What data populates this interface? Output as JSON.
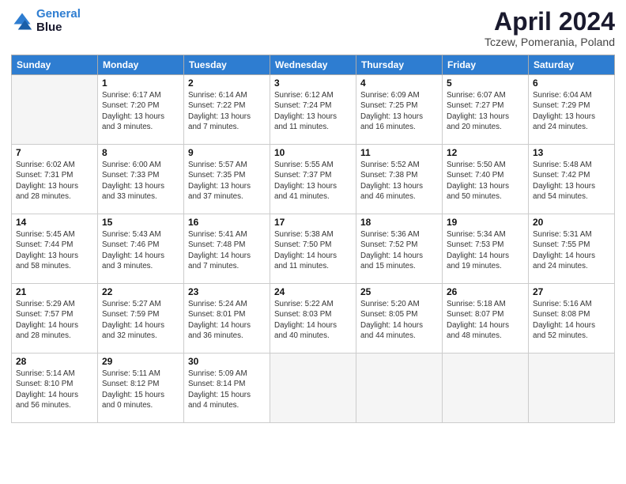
{
  "logo": {
    "line1": "General",
    "line2": "Blue"
  },
  "title": "April 2024",
  "location": "Tczew, Pomerania, Poland",
  "headers": [
    "Sunday",
    "Monday",
    "Tuesday",
    "Wednesday",
    "Thursday",
    "Friday",
    "Saturday"
  ],
  "weeks": [
    [
      {
        "day": "",
        "info": ""
      },
      {
        "day": "1",
        "info": "Sunrise: 6:17 AM\nSunset: 7:20 PM\nDaylight: 13 hours\nand 3 minutes."
      },
      {
        "day": "2",
        "info": "Sunrise: 6:14 AM\nSunset: 7:22 PM\nDaylight: 13 hours\nand 7 minutes."
      },
      {
        "day": "3",
        "info": "Sunrise: 6:12 AM\nSunset: 7:24 PM\nDaylight: 13 hours\nand 11 minutes."
      },
      {
        "day": "4",
        "info": "Sunrise: 6:09 AM\nSunset: 7:25 PM\nDaylight: 13 hours\nand 16 minutes."
      },
      {
        "day": "5",
        "info": "Sunrise: 6:07 AM\nSunset: 7:27 PM\nDaylight: 13 hours\nand 20 minutes."
      },
      {
        "day": "6",
        "info": "Sunrise: 6:04 AM\nSunset: 7:29 PM\nDaylight: 13 hours\nand 24 minutes."
      }
    ],
    [
      {
        "day": "7",
        "info": "Sunrise: 6:02 AM\nSunset: 7:31 PM\nDaylight: 13 hours\nand 28 minutes."
      },
      {
        "day": "8",
        "info": "Sunrise: 6:00 AM\nSunset: 7:33 PM\nDaylight: 13 hours\nand 33 minutes."
      },
      {
        "day": "9",
        "info": "Sunrise: 5:57 AM\nSunset: 7:35 PM\nDaylight: 13 hours\nand 37 minutes."
      },
      {
        "day": "10",
        "info": "Sunrise: 5:55 AM\nSunset: 7:37 PM\nDaylight: 13 hours\nand 41 minutes."
      },
      {
        "day": "11",
        "info": "Sunrise: 5:52 AM\nSunset: 7:38 PM\nDaylight: 13 hours\nand 46 minutes."
      },
      {
        "day": "12",
        "info": "Sunrise: 5:50 AM\nSunset: 7:40 PM\nDaylight: 13 hours\nand 50 minutes."
      },
      {
        "day": "13",
        "info": "Sunrise: 5:48 AM\nSunset: 7:42 PM\nDaylight: 13 hours\nand 54 minutes."
      }
    ],
    [
      {
        "day": "14",
        "info": "Sunrise: 5:45 AM\nSunset: 7:44 PM\nDaylight: 13 hours\nand 58 minutes."
      },
      {
        "day": "15",
        "info": "Sunrise: 5:43 AM\nSunset: 7:46 PM\nDaylight: 14 hours\nand 3 minutes."
      },
      {
        "day": "16",
        "info": "Sunrise: 5:41 AM\nSunset: 7:48 PM\nDaylight: 14 hours\nand 7 minutes."
      },
      {
        "day": "17",
        "info": "Sunrise: 5:38 AM\nSunset: 7:50 PM\nDaylight: 14 hours\nand 11 minutes."
      },
      {
        "day": "18",
        "info": "Sunrise: 5:36 AM\nSunset: 7:52 PM\nDaylight: 14 hours\nand 15 minutes."
      },
      {
        "day": "19",
        "info": "Sunrise: 5:34 AM\nSunset: 7:53 PM\nDaylight: 14 hours\nand 19 minutes."
      },
      {
        "day": "20",
        "info": "Sunrise: 5:31 AM\nSunset: 7:55 PM\nDaylight: 14 hours\nand 24 minutes."
      }
    ],
    [
      {
        "day": "21",
        "info": "Sunrise: 5:29 AM\nSunset: 7:57 PM\nDaylight: 14 hours\nand 28 minutes."
      },
      {
        "day": "22",
        "info": "Sunrise: 5:27 AM\nSunset: 7:59 PM\nDaylight: 14 hours\nand 32 minutes."
      },
      {
        "day": "23",
        "info": "Sunrise: 5:24 AM\nSunset: 8:01 PM\nDaylight: 14 hours\nand 36 minutes."
      },
      {
        "day": "24",
        "info": "Sunrise: 5:22 AM\nSunset: 8:03 PM\nDaylight: 14 hours\nand 40 minutes."
      },
      {
        "day": "25",
        "info": "Sunrise: 5:20 AM\nSunset: 8:05 PM\nDaylight: 14 hours\nand 44 minutes."
      },
      {
        "day": "26",
        "info": "Sunrise: 5:18 AM\nSunset: 8:07 PM\nDaylight: 14 hours\nand 48 minutes."
      },
      {
        "day": "27",
        "info": "Sunrise: 5:16 AM\nSunset: 8:08 PM\nDaylight: 14 hours\nand 52 minutes."
      }
    ],
    [
      {
        "day": "28",
        "info": "Sunrise: 5:14 AM\nSunset: 8:10 PM\nDaylight: 14 hours\nand 56 minutes."
      },
      {
        "day": "29",
        "info": "Sunrise: 5:11 AM\nSunset: 8:12 PM\nDaylight: 15 hours\nand 0 minutes."
      },
      {
        "day": "30",
        "info": "Sunrise: 5:09 AM\nSunset: 8:14 PM\nDaylight: 15 hours\nand 4 minutes."
      },
      {
        "day": "",
        "info": ""
      },
      {
        "day": "",
        "info": ""
      },
      {
        "day": "",
        "info": ""
      },
      {
        "day": "",
        "info": ""
      }
    ]
  ]
}
